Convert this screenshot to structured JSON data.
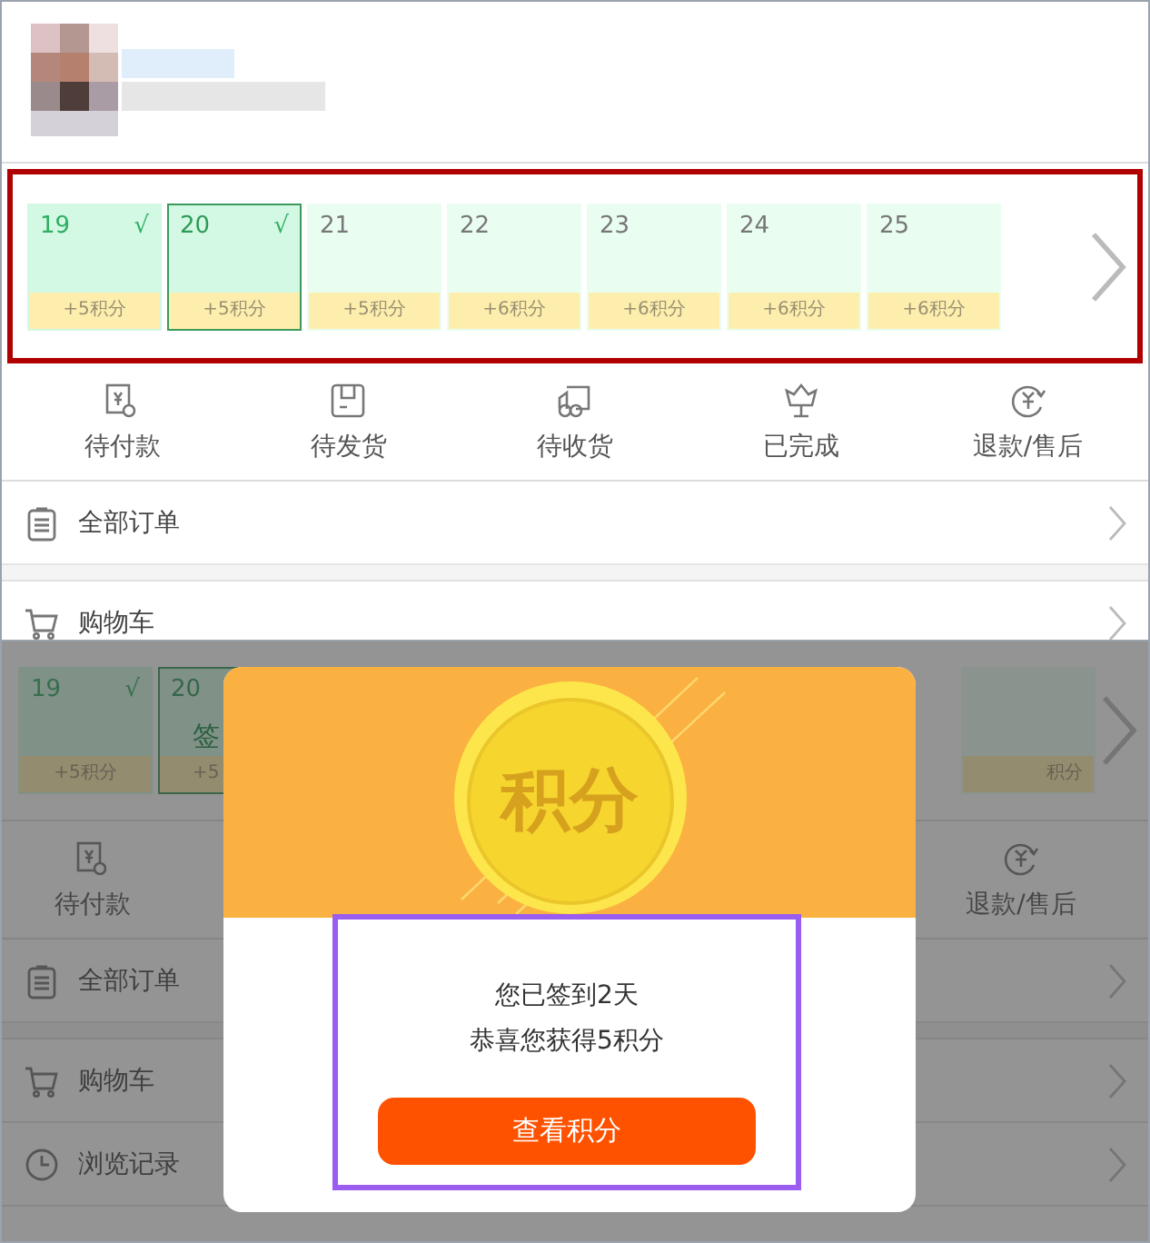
{
  "top_screen": {
    "calendar": {
      "days": [
        {
          "day": "19",
          "mark": "√",
          "checked": true,
          "selected": false,
          "reward": "+5积分"
        },
        {
          "day": "20",
          "mark": "√",
          "checked": true,
          "selected": true,
          "reward": "+5积分"
        },
        {
          "day": "21",
          "checked": false,
          "selected": false,
          "reward": "+5积分"
        },
        {
          "day": "22",
          "checked": false,
          "selected": false,
          "reward": "+6积分"
        },
        {
          "day": "23",
          "checked": false,
          "selected": false,
          "reward": "+6积分"
        },
        {
          "day": "24",
          "checked": false,
          "selected": false,
          "reward": "+6积分"
        },
        {
          "day": "25",
          "checked": false,
          "selected": false,
          "reward": "+6积分"
        }
      ]
    },
    "order_status": [
      {
        "kind": "pay",
        "label": "待付款"
      },
      {
        "kind": "ship",
        "label": "待发货"
      },
      {
        "kind": "receive",
        "label": "待收货"
      },
      {
        "kind": "done",
        "label": "已完成"
      },
      {
        "kind": "refund",
        "label": "退款/售后"
      }
    ],
    "menu": [
      {
        "kind": "orders",
        "label": "全部订单"
      },
      {
        "kind": "cart",
        "label": "购物车"
      }
    ]
  },
  "bottom_screen": {
    "calendar": {
      "days_left": [
        {
          "day": "19",
          "mark": "√",
          "checked": true,
          "selected": false,
          "reward": "+5积分"
        },
        {
          "day": "20",
          "note": "签",
          "checked": true,
          "selected": true,
          "reward": "+5"
        }
      ],
      "days_right": [
        {
          "reward": "积分"
        }
      ]
    },
    "order_status": [
      {
        "kind": "pay",
        "label": "待付款"
      },
      {
        "kind": "refund",
        "label": "退款/售后"
      }
    ],
    "menu": [
      {
        "kind": "orders",
        "label": "全部订单"
      },
      {
        "kind": "cart",
        "label": "购物车"
      },
      {
        "kind": "history",
        "label": "浏览记录"
      }
    ]
  },
  "dialog": {
    "coin_label": "积分",
    "lines": [
      "您已签到2天",
      "恭喜您获得5积分"
    ],
    "button": "查看积分"
  }
}
